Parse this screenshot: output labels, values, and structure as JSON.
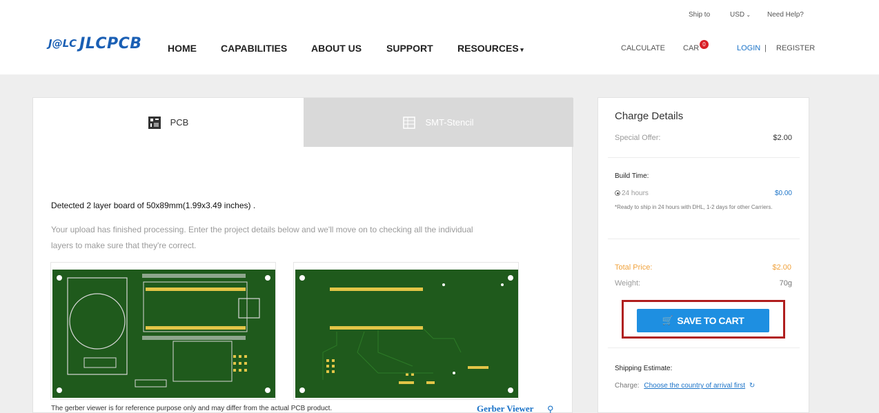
{
  "header": {
    "ship_to": "Ship to",
    "currency": "USD",
    "need_help": "Need Help?",
    "logo_mark": "J@LC",
    "logo_text": "JLCPCB",
    "nav": [
      "HOME",
      "CAPABILITIES",
      "ABOUT US",
      "SUPPORT",
      "RESOURCES"
    ],
    "calculate": "CALCULATE",
    "cart": "CAR",
    "cart_count": "0",
    "login": "LOGIN",
    "separator": "|",
    "register": "REGISTER"
  },
  "tabs": [
    {
      "label": "PCB",
      "active": true
    },
    {
      "label": "SMT-Stencil",
      "active": false
    }
  ],
  "main": {
    "detected": "Detected 2 layer board of 50x89mm(1.99x3.49 inches) .",
    "description": "Your upload has finished processing. Enter the project details below and we'll move on to checking all the individual layers to make sure that they're correct.",
    "disclaimer": "The gerber viewer is for reference purpose only and may differ from the actual PCB product.",
    "gerber_viewer": "Gerber Viewer"
  },
  "charge": {
    "title": "Charge Details",
    "special_offer_label": "Special Offer:",
    "special_offer_value": "$2.00",
    "build_time_title": "Build Time:",
    "build_time_option": "24 hours",
    "build_time_value": "$0.00",
    "build_time_note": "*Ready to ship in 24 hours with DHL, 1-2 days for other Carriers.",
    "total_label": "Total Price:",
    "total_value": "$2.00",
    "weight_label": "Weight:",
    "weight_value": "70g",
    "save_button": "SAVE TO CART",
    "shipping_title": "Shipping Estimate:",
    "charge_label": "Charge:",
    "charge_link": "Choose the country of arrival first"
  },
  "colors": {
    "brand_blue": "#1a5fb4",
    "button_blue": "#1e8fe1",
    "highlight_red": "#b01e1e",
    "price_orange": "#f0a23c",
    "pcb_green": "#1f5a1c"
  }
}
